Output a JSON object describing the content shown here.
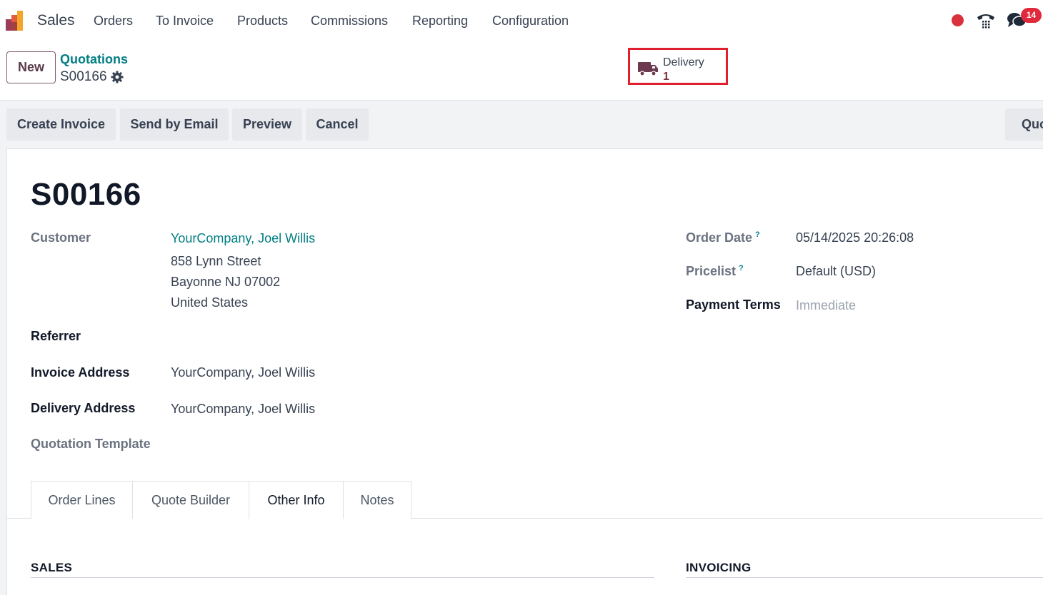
{
  "navbar": {
    "app_name": "Sales",
    "menu": [
      "Orders",
      "To Invoice",
      "Products",
      "Commissions",
      "Reporting",
      "Configuration"
    ],
    "chat_badge": "14"
  },
  "control_panel": {
    "new_label": "New",
    "breadcrumb": "Quotations",
    "record_name": "S00166",
    "smart_button": {
      "label": "Delivery",
      "count": "1"
    }
  },
  "actions": {
    "create_invoice": "Create Invoice",
    "send_by_email": "Send by Email",
    "preview": "Preview",
    "cancel": "Cancel",
    "status": "Quotation"
  },
  "form": {
    "title": "S00166",
    "customer": {
      "label": "Customer",
      "name": "YourCompany, Joel Willis",
      "street": "858 Lynn Street",
      "city": "Bayonne NJ 07002",
      "country": "United States"
    },
    "referrer_label": "Referrer",
    "invoice_address": {
      "label": "Invoice Address",
      "value": "YourCompany, Joel Willis"
    },
    "delivery_address": {
      "label": "Delivery Address",
      "value": "YourCompany, Joel Willis"
    },
    "quotation_template_label": "Quotation Template",
    "order_date": {
      "label": "Order Date",
      "help": "?",
      "value": "05/14/2025 20:26:08"
    },
    "pricelist": {
      "label": "Pricelist",
      "help": "?",
      "value": "Default (USD)"
    },
    "payment_terms": {
      "label": "Payment Terms",
      "value": "Immediate"
    }
  },
  "tabs": [
    "Order Lines",
    "Quote Builder",
    "Other Info",
    "Notes"
  ],
  "active_tab": "Other Info",
  "sections": {
    "sales": "SALES",
    "invoicing": "INVOICING"
  }
}
